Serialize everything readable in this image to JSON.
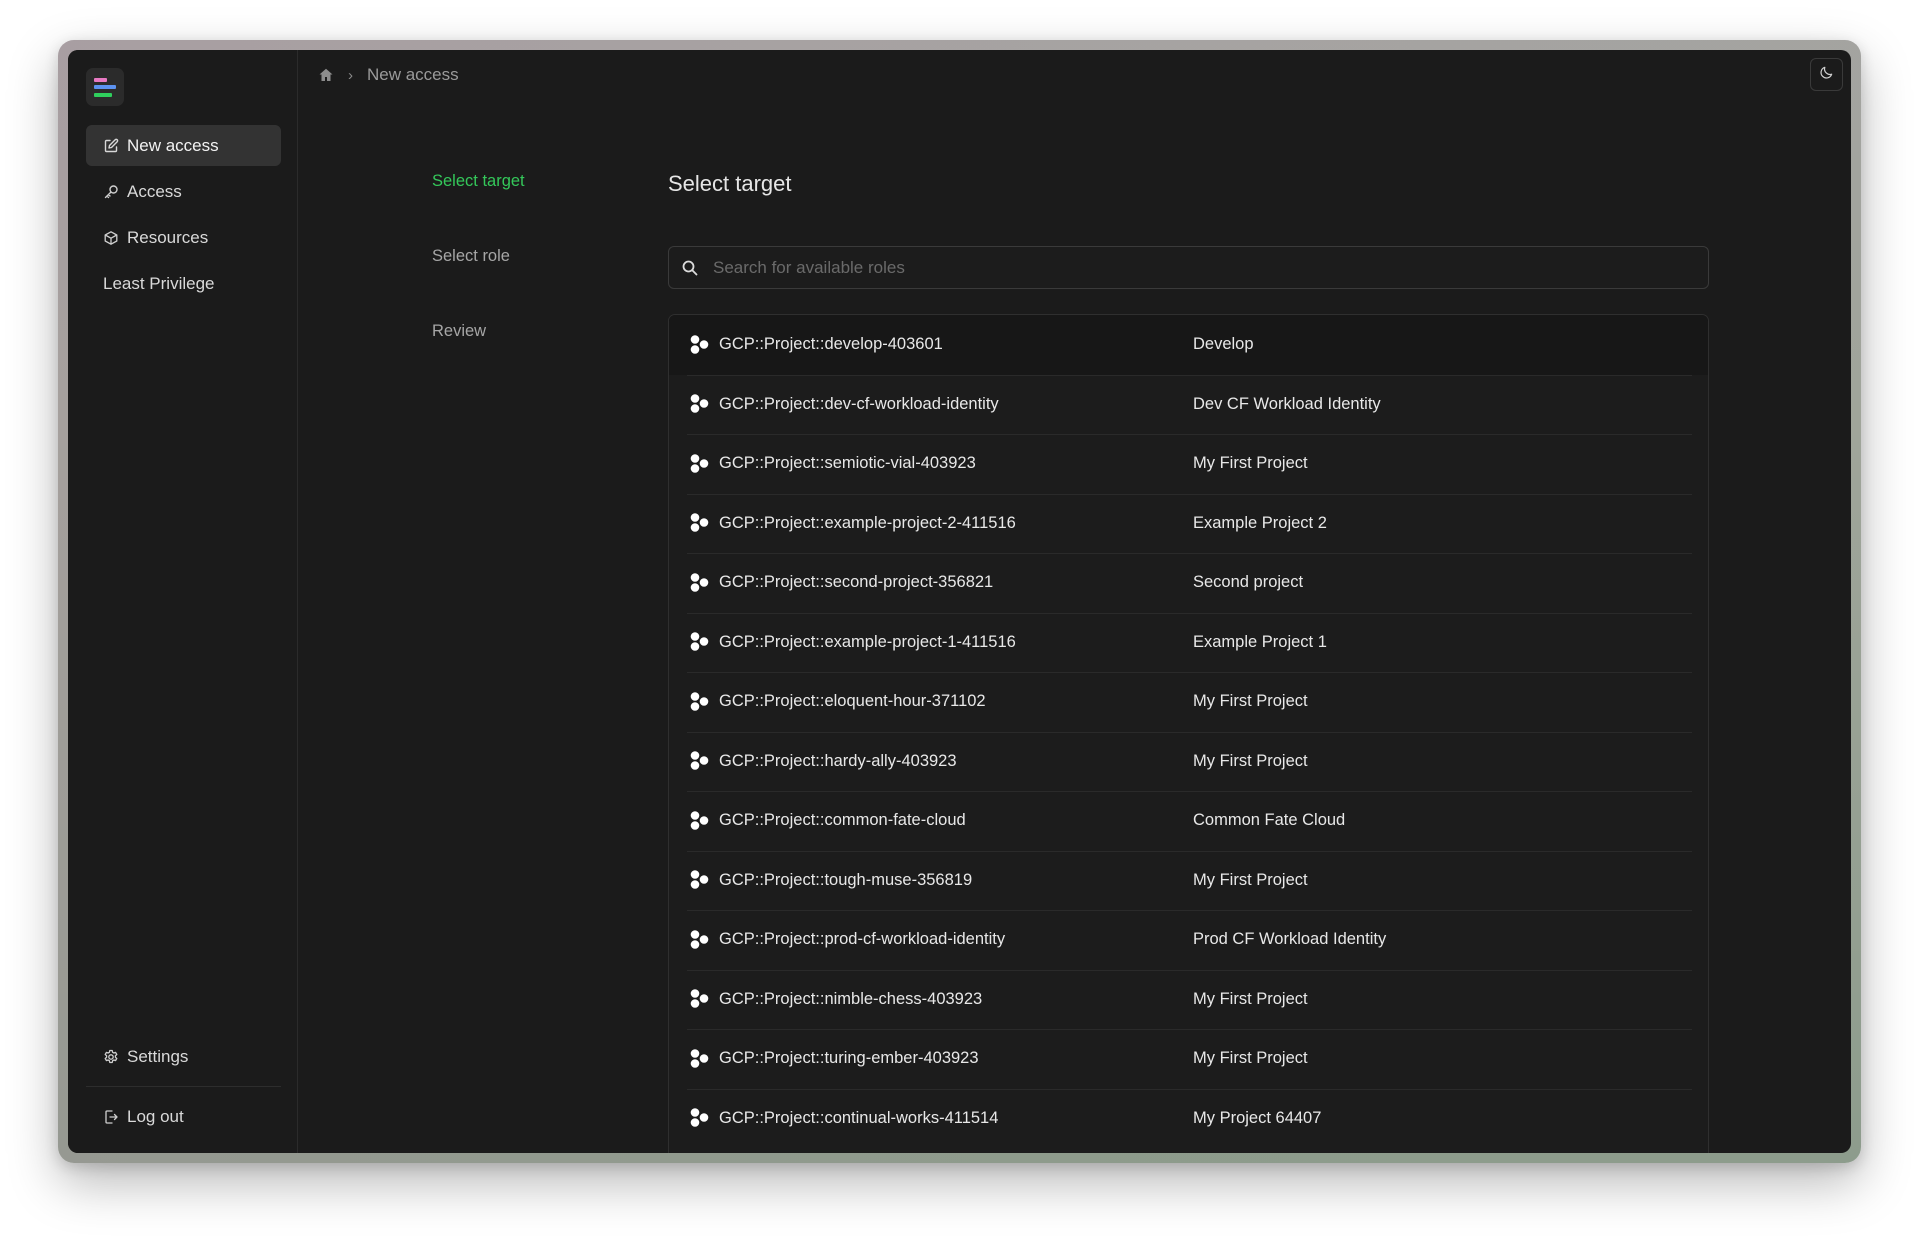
{
  "sidebar": {
    "items": [
      {
        "label": "New access",
        "icon": "edit-icon",
        "active": true
      },
      {
        "label": "Access",
        "icon": "key-icon",
        "active": false
      },
      {
        "label": "Resources",
        "icon": "cube-icon",
        "active": false
      },
      {
        "label": "Least Privilege",
        "icon": null,
        "active": false
      }
    ],
    "bottom": [
      {
        "label": "Settings",
        "icon": "gear-icon"
      },
      {
        "label": "Log out",
        "icon": "logout-icon"
      }
    ]
  },
  "breadcrumb": {
    "home_icon": "home-icon",
    "separator": "›",
    "current": "New access"
  },
  "theme_toggle": {
    "icon": "moon-icon"
  },
  "steps": [
    {
      "label": "Select target",
      "active": true
    },
    {
      "label": "Select role",
      "active": false
    },
    {
      "label": "Review",
      "active": false
    }
  ],
  "main": {
    "title": "Select target",
    "search": {
      "placeholder": "Search for available roles",
      "value": ""
    },
    "targets": [
      {
        "id": "GCP::Project::develop-403601",
        "name": "Develop"
      },
      {
        "id": "GCP::Project::dev-cf-workload-identity",
        "name": "Dev CF Workload Identity"
      },
      {
        "id": "GCP::Project::semiotic-vial-403923",
        "name": "My First Project"
      },
      {
        "id": "GCP::Project::example-project-2-411516",
        "name": "Example Project 2"
      },
      {
        "id": "GCP::Project::second-project-356821",
        "name": "Second project"
      },
      {
        "id": "GCP::Project::example-project-1-411516",
        "name": "Example Project 1"
      },
      {
        "id": "GCP::Project::eloquent-hour-371102",
        "name": "My First Project"
      },
      {
        "id": "GCP::Project::hardy-ally-403923",
        "name": "My First Project"
      },
      {
        "id": "GCP::Project::common-fate-cloud",
        "name": "Common Fate Cloud"
      },
      {
        "id": "GCP::Project::tough-muse-356819",
        "name": "My First Project"
      },
      {
        "id": "GCP::Project::prod-cf-workload-identity",
        "name": "Prod CF Workload Identity"
      },
      {
        "id": "GCP::Project::nimble-chess-403923",
        "name": "My First Project"
      },
      {
        "id": "GCP::Project::turing-ember-403923",
        "name": "My First Project"
      },
      {
        "id": "GCP::Project::continual-works-411514",
        "name": "My Project 64407"
      }
    ],
    "highlighted_index": 0
  },
  "colors": {
    "accent_green": "#34c85a",
    "logo_pink": "#e879c3",
    "logo_blue": "#5c92f0",
    "logo_green": "#2fcf5d"
  }
}
